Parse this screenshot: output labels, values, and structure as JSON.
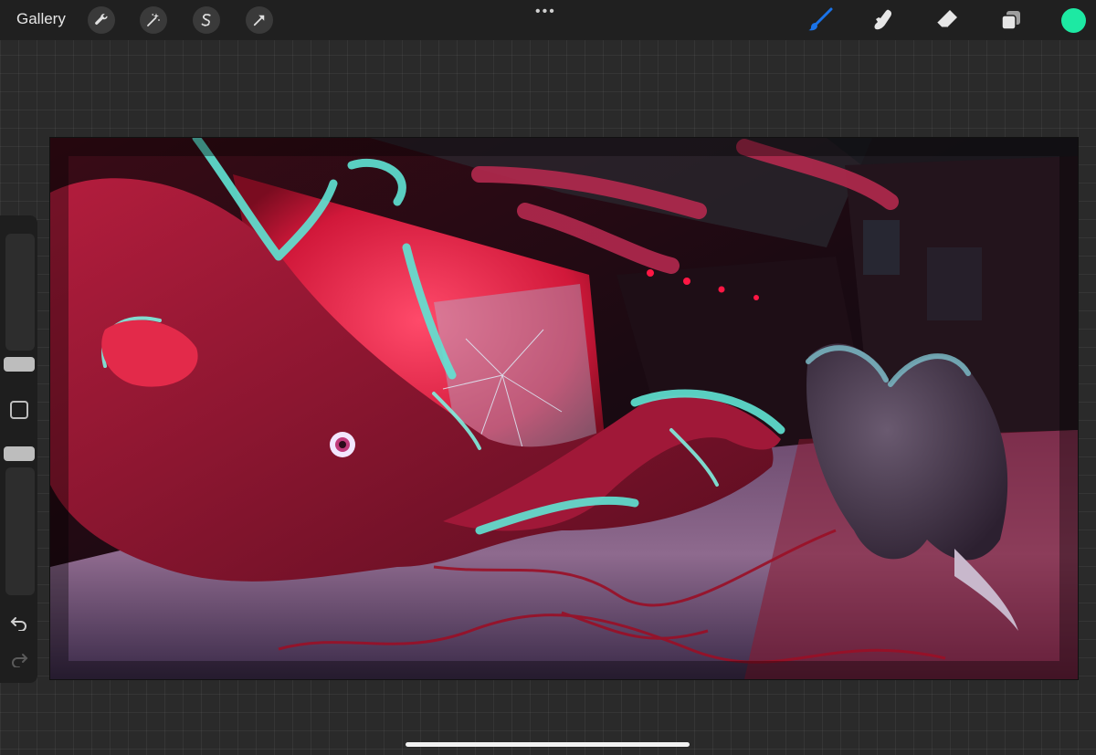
{
  "app": {
    "gallery_label": "Gallery",
    "more_label": "•••"
  },
  "toolbar_left": [
    {
      "name": "actions",
      "icon": "wrench-icon"
    },
    {
      "name": "adjustments",
      "icon": "magic-wand-icon"
    },
    {
      "name": "selection",
      "icon": "selection-s-icon"
    },
    {
      "name": "transform",
      "icon": "arrow-cursor-icon"
    }
  ],
  "toolbar_right": [
    {
      "name": "brush",
      "icon": "brush-icon",
      "active": true
    },
    {
      "name": "smudge",
      "icon": "smudge-finger-icon"
    },
    {
      "name": "eraser",
      "icon": "eraser-icon"
    },
    {
      "name": "layers",
      "icon": "layers-icon"
    }
  ],
  "colors": {
    "accent": "#1a73e8",
    "current_color": "#1de9a3",
    "toolbar_bg": "#202020",
    "workspace_bg": "#2a2a2a"
  },
  "sidebar": {
    "brush_size_level": 0.55,
    "opacity_level": 0.55,
    "undo_icon": "undo-icon",
    "redo_icon": "redo-icon",
    "modify_icon": "square-modify-icon"
  },
  "canvas": {
    "description_icon": "artwork-canvas"
  }
}
